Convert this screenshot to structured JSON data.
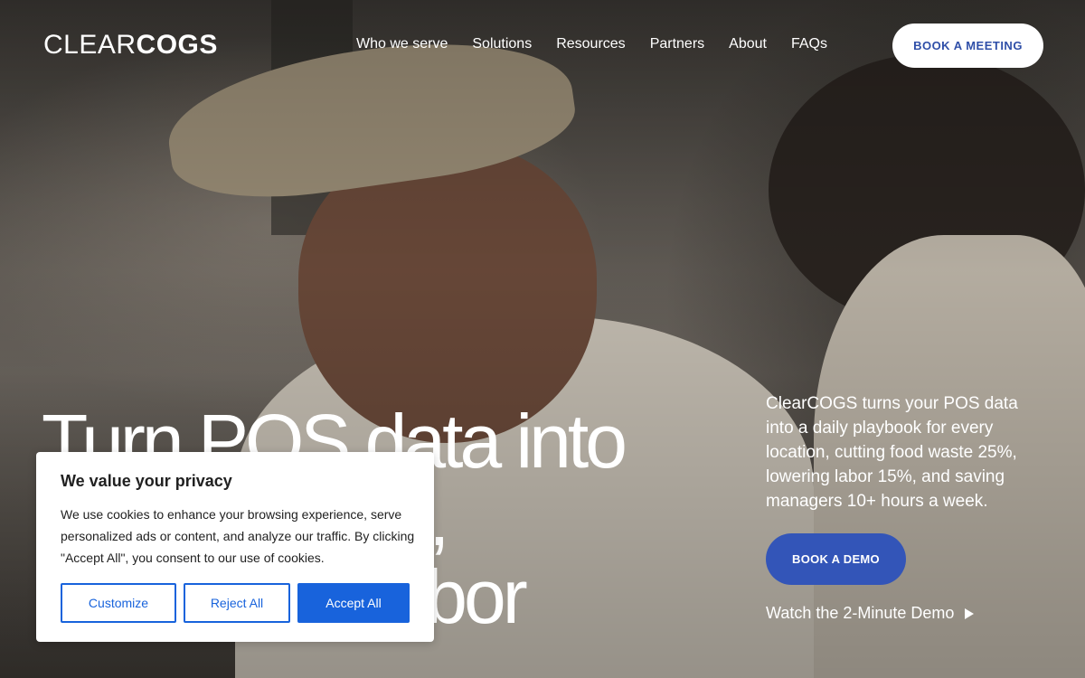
{
  "logo": {
    "part1": "CLEAR",
    "part2": "COGS"
  },
  "nav": {
    "items": [
      {
        "label": "Who we serve"
      },
      {
        "label": "Solutions"
      },
      {
        "label": "Resources"
      },
      {
        "label": "Partners"
      },
      {
        "label": "About"
      },
      {
        "label": "FAQs"
      }
    ],
    "cta_label": "BOOK A MEETING"
  },
  "hero": {
    "headline_lines": [
      "Turn POS data into",
      "smarter prep,",
      "ordering & labor"
    ],
    "intro": "ClearCOGS turns your POS data into a daily playbook for every location, cutting food waste 25%, lowering labor 15%, and saving managers 10+ hours a week.",
    "demo_button": "BOOK A DEMO",
    "watch_link": "Watch the 2-Minute Demo"
  },
  "cookie_banner": {
    "title": "We value your privacy",
    "text": "We use cookies to enhance your browsing experience, serve personalized ads or content, and analyze our traffic. By clicking \"Accept All\", you consent to our use of cookies.",
    "customize_label": "Customize",
    "reject_label": "Reject All",
    "accept_label": "Accept All"
  },
  "colors": {
    "brand_blue": "#3355b8",
    "cookie_accent": "#1863dc"
  },
  "icons": {
    "play": "play-icon"
  }
}
